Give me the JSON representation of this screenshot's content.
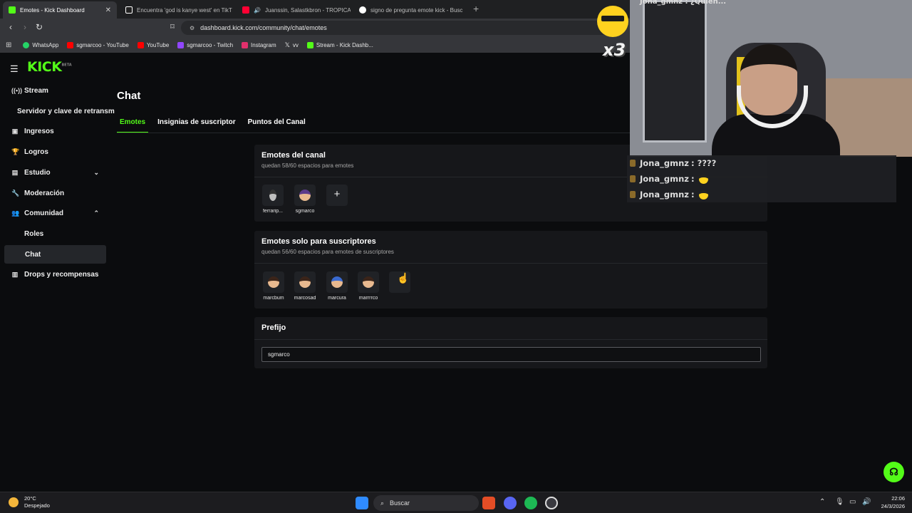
{
  "browser": {
    "tabs": [
      {
        "title": "Emotes - Kick Dashboard",
        "active": true,
        "color": "#53fc18"
      },
      {
        "title": "Encuentra 'god is kanye west' en TikT",
        "active": false,
        "color": "#ffffff"
      },
      {
        "title": "Juanssin, Salastkbron - TROPICAL",
        "active": false,
        "color": "#ff0033"
      },
      {
        "title": "signo de pregunta emote kick - Busc",
        "active": false,
        "color": "#ffffff"
      }
    ],
    "url": "dashboard.kick.com/community/chat/emotes",
    "bookmarks": [
      {
        "label": "WhatsApp",
        "color": "#25d366"
      },
      {
        "label": "sgmarcoo - YouTube",
        "color": "#ff0000"
      },
      {
        "label": "YouTube",
        "color": "#ff0000"
      },
      {
        "label": "sgmarcoo - Twitch",
        "color": "#9146ff"
      },
      {
        "label": "Instagram",
        "color": "#e1306c"
      },
      {
        "label": "vv",
        "color": "#e6e6e6"
      },
      {
        "label": "Stream - Kick Dashb...",
        "color": "#53fc18"
      }
    ]
  },
  "brand": {
    "logo": "KICK",
    "beta": "BETA",
    "accent": "#53fc18"
  },
  "sidebar": {
    "items": [
      {
        "label": "Stream",
        "icon": "broadcast-icon"
      },
      {
        "label": "Servidor y clave de retransm",
        "icon": ""
      },
      {
        "label": "Ingresos",
        "icon": "wallet-icon"
      },
      {
        "label": "Logros",
        "icon": "trophy-icon"
      },
      {
        "label": "Estudio",
        "icon": "layout-icon"
      },
      {
        "label": "Moderación",
        "icon": "wrench-icon"
      },
      {
        "label": "Comunidad",
        "icon": "people-icon"
      },
      {
        "label": "Roles",
        "icon": ""
      },
      {
        "label": "Chat",
        "icon": ""
      },
      {
        "label": "Drops y recompensas",
        "icon": "chart-icon"
      }
    ]
  },
  "main": {
    "title": "Chat",
    "tabs": [
      "Emotes",
      "Insignias de suscriptor",
      "Puntos del Canal"
    ],
    "channel_emotes": {
      "title": "Emotes del canal",
      "subtitle": "quedan 58/60 espacios para emotes",
      "emotes": [
        "ferrarip...",
        "sgmarco"
      ],
      "add": "+"
    },
    "sub_emotes": {
      "title": "Emotes solo para suscriptores",
      "subtitle": "quedan 56/60 espacios para emotes de suscriptores",
      "emotes": [
        "marcbum",
        "marcosad",
        "marcura",
        "marrrrco"
      ]
    },
    "prefix": {
      "title": "Prefijo",
      "value": "sgmarco"
    }
  },
  "overlay": {
    "top_text": "Jona_gmnz : ¿Quién...",
    "multiplier": "x3",
    "chat": [
      {
        "user": "Jona_gmnz",
        "text": ": ????",
        "emote": false
      },
      {
        "user": "Jona_gmnz",
        "text": ":",
        "emote": true
      },
      {
        "user": "Jona_gmnz",
        "text": ":",
        "emote": true
      }
    ]
  },
  "taskbar": {
    "temp": "20°C",
    "weather": "Despejado",
    "search": "Buscar",
    "time": "22:06",
    "date": "24/3/2026"
  }
}
